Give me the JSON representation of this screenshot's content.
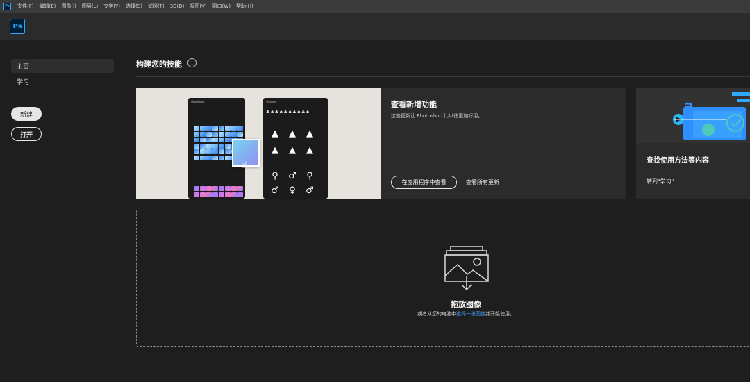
{
  "menubar": {
    "app_badge": "Ps",
    "items": [
      "文件(F)",
      "编辑(E)",
      "图像(I)",
      "图层(L)",
      "文字(Y)",
      "选择(S)",
      "滤镜(T)",
      "3D(D)",
      "视图(V)",
      "窗口(W)",
      "帮助(H)"
    ]
  },
  "header": {
    "logo": "Ps"
  },
  "sidebar": {
    "items": [
      {
        "label": "主页",
        "active": true
      },
      {
        "label": "学习",
        "active": false
      }
    ],
    "new_button": "新建",
    "open_button": "打开"
  },
  "main": {
    "section_title": "构建您的技能",
    "info_icon": "i",
    "whats_new": {
      "title": "查看新增功能",
      "description": "这些更新让 Photoshop 比以往更加好用。",
      "button": "在应用程序中查看",
      "link": "查看所有更新",
      "image": {
        "panel_left_title": "Gradients",
        "panel_right_title": "Shapes"
      }
    },
    "learn": {
      "title": "查找使用方法等内容",
      "link": "转到\"学习\""
    },
    "dropzone": {
      "title": "拖放图像",
      "desc_before": "或者从您的电脑中",
      "desc_link": "选择一张图像",
      "desc_after": "并开始使用。"
    }
  },
  "colors": {
    "accent_blue": "#31a8ff",
    "link_blue": "#3d9cf5",
    "background": "#1e1e1e",
    "card": "#2b2b2b"
  }
}
